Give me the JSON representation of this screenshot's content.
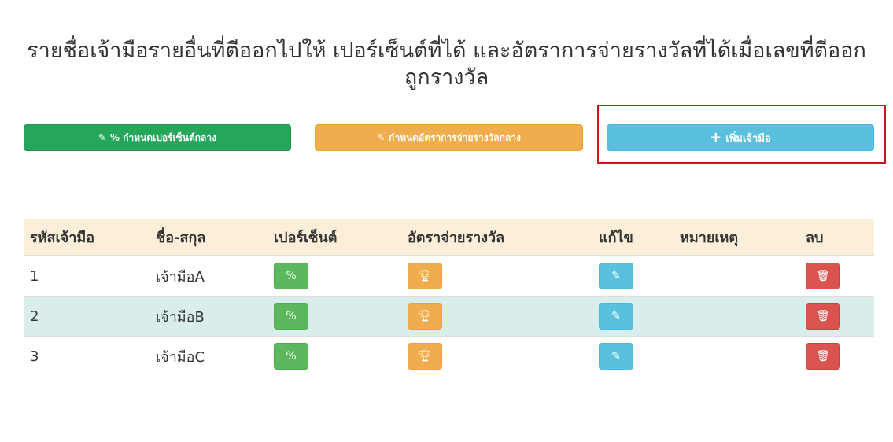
{
  "page": {
    "title": "รายชื่อเจ้ามือรายอื่นที่ตีออกไปให้ เปอร์เซ็นต์ที่ได้ และอัตราการจ่ายรางวัลที่ได้เมื่อเลขที่ตีออกถูกรางวัล"
  },
  "toolbar": {
    "set_percent_label": "% กำหนดเปอร์เซ็นต์กลาง",
    "set_payout_label": "กำหนดอัตราการจ่ายรางวัลกลาง",
    "add_dealer_label": "เพิ่มเจ้ามือ",
    "colors": {
      "green": "#26a65b",
      "orange": "#f0ad4e",
      "cyan": "#5bc0de",
      "highlight": "#c9171e"
    }
  },
  "table": {
    "headers": [
      "รหัสเจ้ามือ",
      "ชื่อ-สกุล",
      "เปอร์เซ็นต์",
      "อัตราจ่ายรางวัล",
      "แก้ไข",
      "หมายเหตุ",
      "ลบ"
    ],
    "rows": [
      {
        "id": "1",
        "name": "เจ้ามือA",
        "note": ""
      },
      {
        "id": "2",
        "name": "เจ้ามือB",
        "note": ""
      },
      {
        "id": "3",
        "name": "เจ้ามือC",
        "note": ""
      }
    ],
    "percent_button_label": "%",
    "icons": {
      "payout": "trophy-icon",
      "edit": "edit-icon",
      "delete": "trash-icon"
    }
  }
}
